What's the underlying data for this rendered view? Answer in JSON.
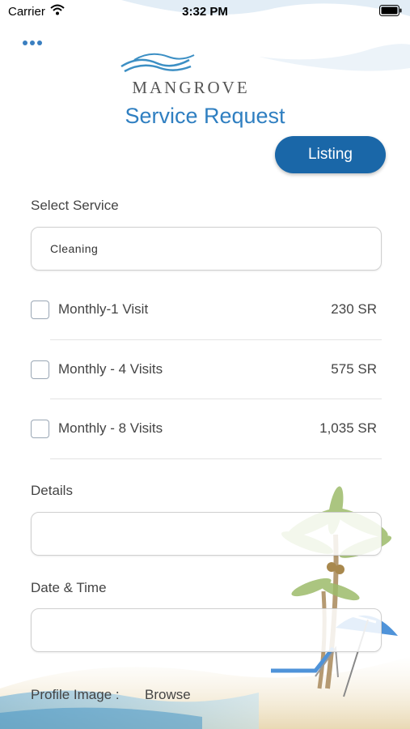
{
  "status_bar": {
    "carrier": "Carrier",
    "time": "3:32 PM"
  },
  "logo": {
    "text": "MANGROVE"
  },
  "page_title": "Service Request",
  "listing_button_label": "Listing",
  "select_service": {
    "label": "Select Service",
    "value": "Cleaning"
  },
  "options": [
    {
      "label": "Monthly-1 Visit",
      "price": "230 SR",
      "checked": false
    },
    {
      "label": "Monthly - 4 Visits",
      "price": "575 SR",
      "checked": false
    },
    {
      "label": "Monthly - 8 Visits",
      "price": "1,035 SR",
      "checked": false
    }
  ],
  "details": {
    "label": "Details",
    "value": ""
  },
  "date_time": {
    "label": "Date & Time",
    "value": ""
  },
  "profile_image": {
    "label": "Profile Image :",
    "browse_label": "Browse"
  },
  "colors": {
    "accent": "#2f7fc1",
    "button": "#1a67a8"
  }
}
